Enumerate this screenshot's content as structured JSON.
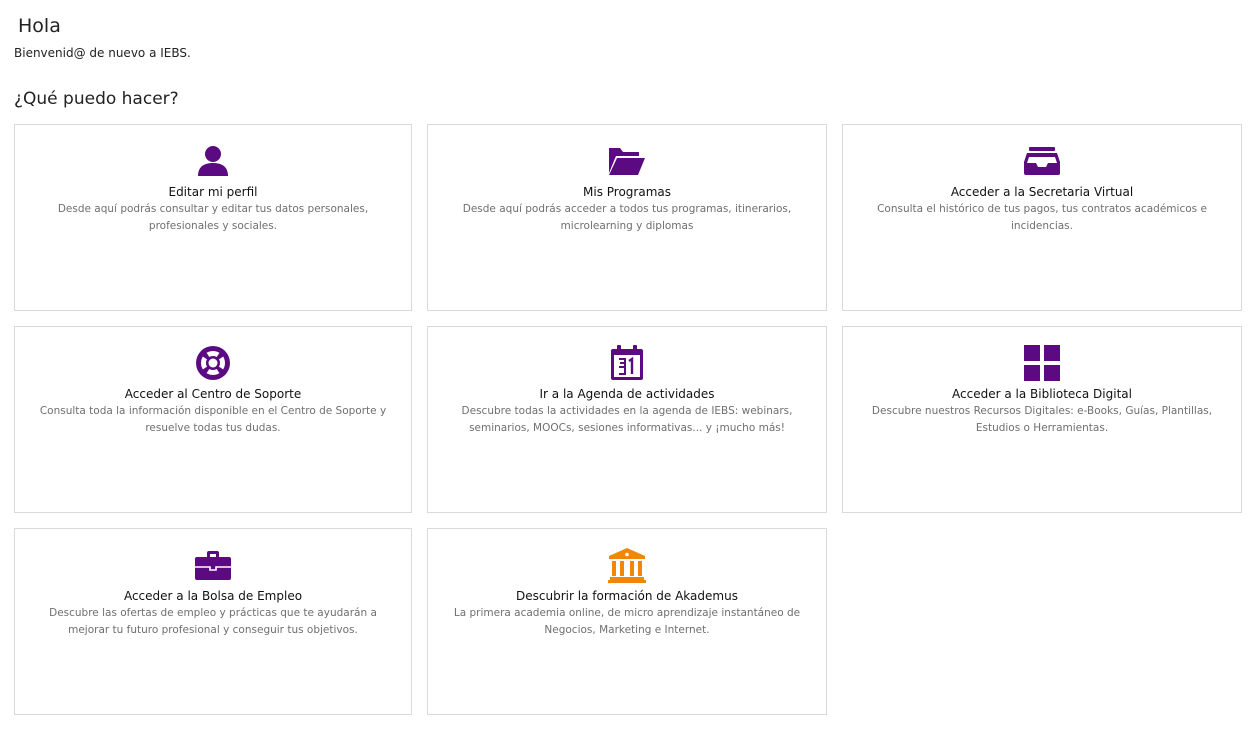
{
  "header": {
    "greeting": "Hola",
    "welcome": "Bienvenid@ de nuevo a IEBS."
  },
  "section": {
    "title": "¿Qué puedo hacer?"
  },
  "colors": {
    "accent": "#5b0a82",
    "accent_alt": "#f2860b"
  },
  "cards": [
    {
      "icon": "user-icon",
      "title": "Editar mi perfil",
      "description": "Desde aquí podrás consultar y editar tus datos personales, profesionales y sociales."
    },
    {
      "icon": "folder-open-icon",
      "title": "Mis Programas",
      "description": "Desde aquí podrás acceder a todos tus programas, itinerarios, microlearning y diplomas"
    },
    {
      "icon": "inbox-tray-icon",
      "title": "Acceder a la Secretaria Virtual",
      "description": "Consulta el histórico de tus pagos, tus contratos académicos e incidencias."
    },
    {
      "icon": "life-ring-icon",
      "title": "Acceder al Centro de Soporte",
      "description": "Consulta toda la información disponible en el Centro de Soporte y resuelve todas tus dudas."
    },
    {
      "icon": "calendar-icon",
      "title": "Ir a la Agenda de actividades",
      "description": "Descubre todas la actividades en la agenda de IEBS: webinars, seminarios, MOOCs, sesiones informativas... y ¡mucho más!"
    },
    {
      "icon": "grid-icon",
      "title": "Acceder a la Biblioteca Digital",
      "description": "Descubre nuestros Recursos Digitales: e-Books, Guías, Plantillas, Estudios o Herramientas."
    },
    {
      "icon": "briefcase-icon",
      "title": "Acceder a la Bolsa de Empleo",
      "description": "Descubre las ofertas de empleo y prácticas que te ayudarán a mejorar tu futuro profesional y conseguir tus objetivos."
    },
    {
      "icon": "institution-icon",
      "title": "Descubrir la formación de Akademus",
      "description": "La primera academia online, de micro aprendizaje instantáneo de Negocios, Marketing e Internet."
    }
  ]
}
